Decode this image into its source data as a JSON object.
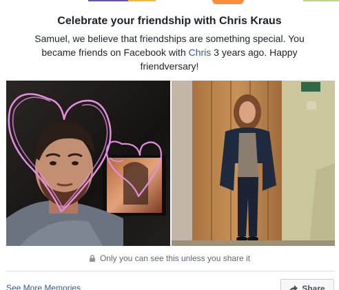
{
  "memory": {
    "title": "Celebrate your friendship with Chris Kraus",
    "message_part1": "Samuel, we believe that friendships are something special. You became friends on Facebook with ",
    "friend_link": "Chris",
    "message_part2": " 3 years ago. Happy friendversary!"
  },
  "photos": {
    "left_icon": "friend-photo-with-heart-doodles",
    "right_icon": "friend-photo-standing-by-door"
  },
  "privacy": {
    "icon": "lock-icon",
    "text": "Only you can see this unless you share it"
  },
  "footer": {
    "see_more_label": "See More Memories",
    "share_label": "Share",
    "share_icon": "share-arrow-icon"
  },
  "colors": {
    "link": "#365899",
    "heart_doodle": "#e48ee0"
  }
}
